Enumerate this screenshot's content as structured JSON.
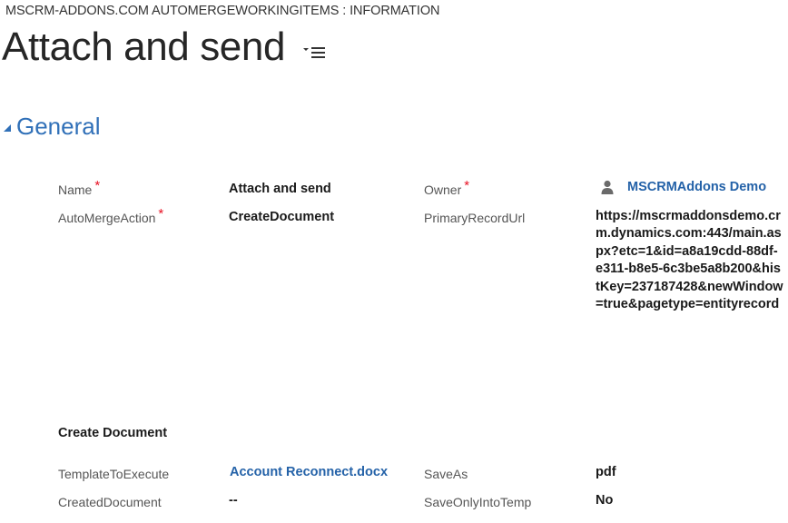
{
  "header": {
    "entity_breadcrumb": "MSCRM-ADDONS.COM AUTOMERGEWORKINGITEMS : INFORMATION",
    "record_title": "Attach and send",
    "form_menu_icon": "form-selector-menu-icon"
  },
  "section": {
    "title": "General",
    "toggle_icon": "collapse-triangle-icon"
  },
  "fields": {
    "name": {
      "label": "Name",
      "required_marker": "*",
      "value": "Attach and send"
    },
    "owner": {
      "label": "Owner",
      "required_marker": "*",
      "value": "MSCRMAddons Demo",
      "icon": "user-icon"
    },
    "automerge_action": {
      "label": "AutoMergeAction",
      "required_marker": "*",
      "value": "CreateDocument"
    },
    "primary_record_url": {
      "label": "PrimaryRecordUrl",
      "value": "https://mscrmaddonsdemo.crm.dynamics.com:443/main.aspx?etc=1&id=a8a19cdd-88df-e311-b8e5-6c3be5a8b200&histKey=237187428&newWindow=true&pagetype=entityrecord"
    }
  },
  "subsection": {
    "title": "Create Document"
  },
  "create_document_fields": {
    "template_to_execute": {
      "label": "TemplateToExecute",
      "value": "Account Reconnect.docx"
    },
    "save_as": {
      "label": "SaveAs",
      "value": "pdf"
    },
    "created_document": {
      "label": "CreatedDocument",
      "value": "--"
    },
    "save_only_into_temp": {
      "label": "SaveOnlyIntoTemp",
      "value": "No"
    }
  },
  "colors": {
    "section_title": "#3070b8",
    "link": "#2462a8",
    "required": "#e81123"
  }
}
